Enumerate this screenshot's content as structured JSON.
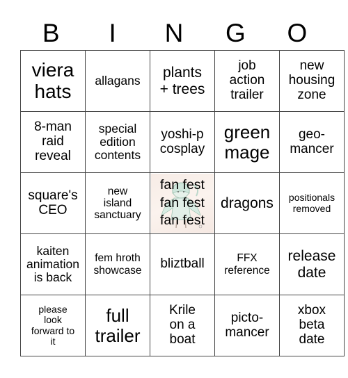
{
  "header": {
    "letters": [
      "B",
      "I",
      "N",
      "G",
      "O"
    ]
  },
  "free_space": {
    "lines": [
      "fan fest",
      "fan fest",
      "fan fest"
    ],
    "image": "chibi-character-illustration"
  },
  "cells": [
    [
      "viera hats",
      "allagans",
      "plants + trees",
      "job action trailer",
      "new housing zone"
    ],
    [
      "8-man raid reveal",
      "special edition contents",
      "yoshi-p cosplay",
      "green mage",
      "geo-mancer"
    ],
    [
      "square's CEO",
      "new island sanctuary",
      "fan fest fan fest fan fest",
      "dragons",
      "positionals removed"
    ],
    [
      "kaiten animation is back",
      "fem hroth showcase",
      "bliztball",
      "FFX reference",
      "release date"
    ],
    [
      "please look forward to it",
      "full trailer",
      "Krile on a boat",
      "picto-mancer",
      "xbox beta date"
    ]
  ],
  "cell_lines": {
    "r0c0": [
      "viera",
      "hats"
    ],
    "r0c1": [
      "allagans"
    ],
    "r0c2": [
      "plants",
      "+ trees"
    ],
    "r0c3": [
      "job",
      "action",
      "trailer"
    ],
    "r0c4": [
      "new",
      "housing",
      "zone"
    ],
    "r1c0": [
      "8-man",
      "raid",
      "reveal"
    ],
    "r1c1": [
      "special",
      "edition",
      "contents"
    ],
    "r1c2": [
      "yoshi-p",
      "cosplay"
    ],
    "r1c3": [
      "green",
      "mage"
    ],
    "r1c4": [
      "geo-",
      "mancer"
    ],
    "r2c0": [
      "square's",
      "CEO"
    ],
    "r2c1": [
      "new",
      "island",
      "sanctuary"
    ],
    "r2c3": [
      "dragons"
    ],
    "r2c4": [
      "positionals",
      "removed"
    ],
    "r3c0": [
      "kaiten",
      "animation",
      "is back"
    ],
    "r3c1": [
      "fem hroth",
      "showcase"
    ],
    "r3c2": [
      "bliztball"
    ],
    "r3c3": [
      "FFX",
      "reference"
    ],
    "r3c4": [
      "release",
      "date"
    ],
    "r4c0": [
      "please",
      "look",
      "forward to",
      "it"
    ],
    "r4c1": [
      "full",
      "trailer"
    ],
    "r4c2": [
      "Krile",
      "on a",
      "boat"
    ],
    "r4c3": [
      "picto-",
      "mancer"
    ],
    "r4c4": [
      "xbox",
      "beta",
      "date"
    ]
  },
  "colors": {
    "grid_line": "#444444",
    "text": "#000000",
    "free_bg": "#f8ede7",
    "figure": "#cfe6dc"
  }
}
